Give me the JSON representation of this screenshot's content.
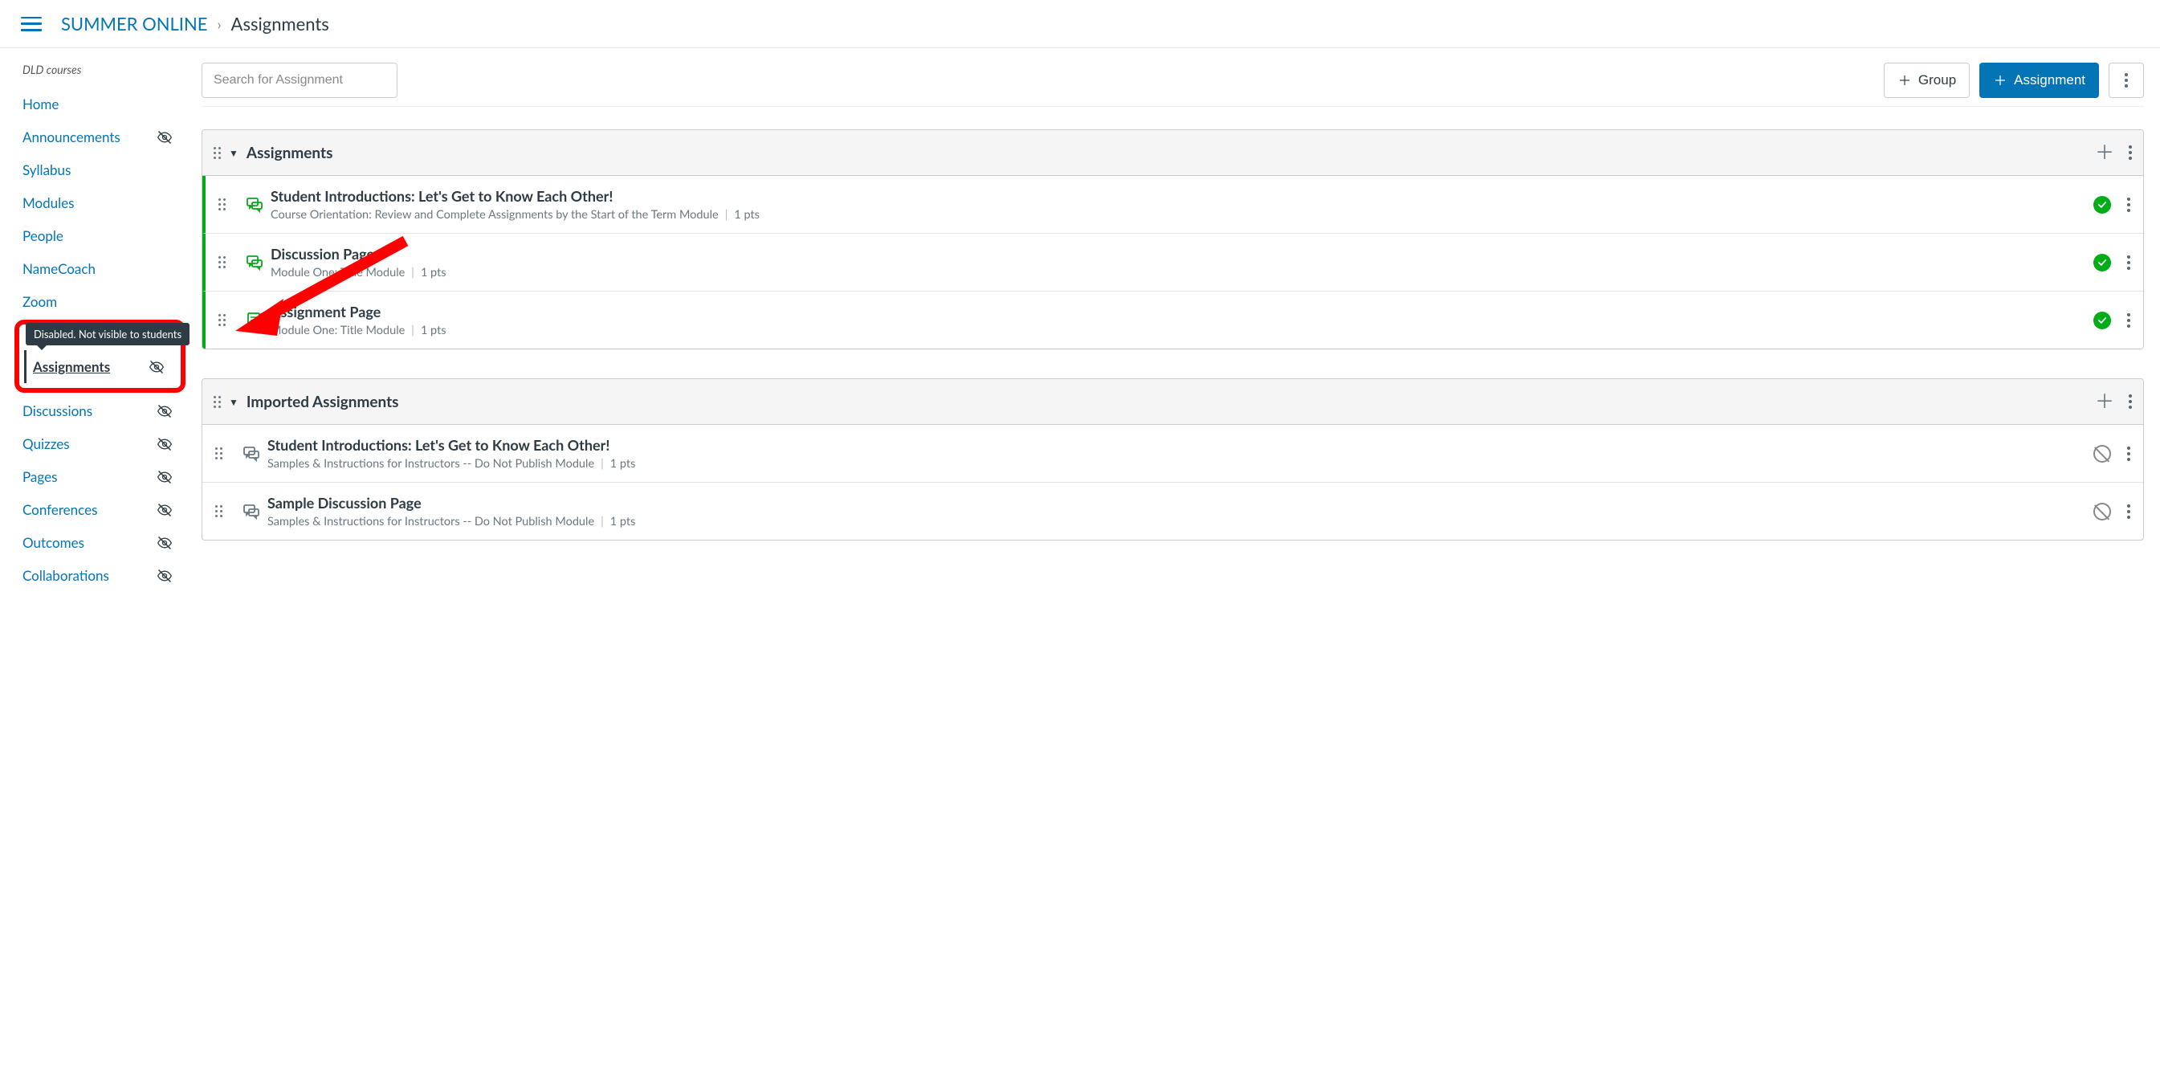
{
  "breadcrumb": {
    "course": "SUMMER ONLINE",
    "current": "Assignments"
  },
  "sidebar": {
    "title": "DLD courses",
    "tooltip": "Disabled. Not visible to students",
    "items": [
      {
        "label": "Home",
        "hidden": false,
        "active": false
      },
      {
        "label": "Announcements",
        "hidden": true,
        "active": false
      },
      {
        "label": "Syllabus",
        "hidden": false,
        "active": false
      },
      {
        "label": "Modules",
        "hidden": false,
        "active": false
      },
      {
        "label": "People",
        "hidden": false,
        "active": false
      },
      {
        "label": "NameCoach",
        "hidden": false,
        "active": false
      },
      {
        "label": "Zoom",
        "hidden": false,
        "active": false
      },
      {
        "label": "Assignments",
        "hidden": true,
        "active": true
      },
      {
        "label": "Discussions",
        "hidden": true,
        "active": false
      },
      {
        "label": "Quizzes",
        "hidden": true,
        "active": false
      },
      {
        "label": "Pages",
        "hidden": true,
        "active": false
      },
      {
        "label": "Conferences",
        "hidden": true,
        "active": false
      },
      {
        "label": "Outcomes",
        "hidden": true,
        "active": false
      },
      {
        "label": "Collaborations",
        "hidden": true,
        "active": false
      }
    ]
  },
  "toolbar": {
    "search_placeholder": "Search for Assignment",
    "group_label": "Group",
    "assignment_label": "Assignment"
  },
  "groups": [
    {
      "title": "Assignments",
      "items": [
        {
          "title": "Student Introductions: Let's Get to Know Each Other!",
          "meta": "Course Orientation: Review and Complete Assignments by the Start of the Term Module",
          "pts": "1 pts",
          "type": "discussion",
          "published": true
        },
        {
          "title": "Discussion Page",
          "meta": "Module One: Title Module",
          "pts": "1 pts",
          "type": "discussion",
          "published": true
        },
        {
          "title": "Assignment Page",
          "meta": "Module One: Title Module",
          "pts": "1 pts",
          "type": "assignment",
          "published": true
        }
      ]
    },
    {
      "title": "Imported Assignments",
      "items": [
        {
          "title": "Student Introductions: Let's Get to Know Each Other!",
          "meta": "Samples & Instructions for Instructors -- Do Not Publish Module",
          "pts": "1 pts",
          "type": "discussion",
          "published": false
        },
        {
          "title": "Sample Discussion Page",
          "meta": "Samples & Instructions for Instructors -- Do Not Publish Module",
          "pts": "1 pts",
          "type": "discussion",
          "published": false
        }
      ]
    }
  ]
}
